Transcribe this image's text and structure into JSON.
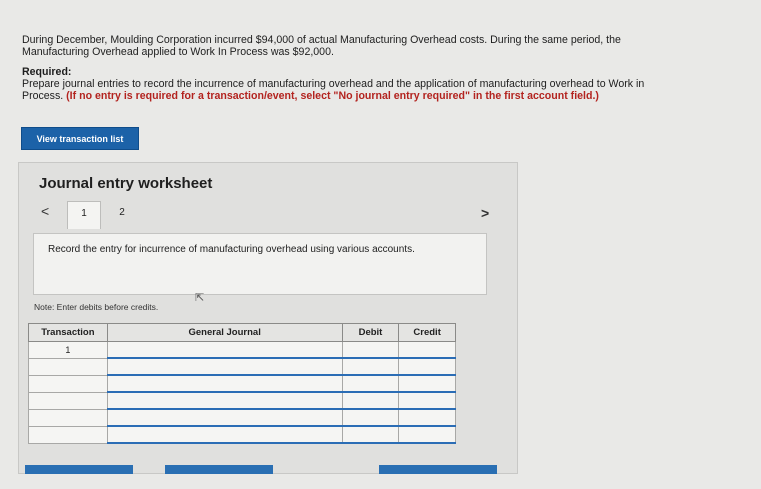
{
  "problem": {
    "line1": "During December, Moulding Corporation incurred $94,000 of actual Manufacturing Overhead costs. During the same period, the",
    "line2": "Manufacturing Overhead applied to Work In Process was $92,000."
  },
  "required": {
    "heading": "Required:",
    "line1": "Prepare journal entries to record the incurrence of manufacturing overhead and the application of manufacturing overhead to Work in",
    "line2_plain": "Process. ",
    "line2_warn": "(If no entry is required for a transaction/event, select \"No journal entry required\" in the first account field.)"
  },
  "view_button": "View transaction list",
  "worksheet": {
    "title": "Journal entry worksheet",
    "prev_glyph": "<",
    "next_glyph": ">",
    "tabs": [
      "1",
      "2"
    ],
    "instruction": "Record the entry for incurrence of manufacturing overhead using various accounts.",
    "note": "Note: Enter debits before credits.",
    "table": {
      "headers": [
        "Transaction",
        "General Journal",
        "Debit",
        "Credit"
      ],
      "rows": [
        [
          "1",
          "",
          "",
          ""
        ],
        [
          "",
          "",
          "",
          ""
        ],
        [
          "",
          "",
          "",
          ""
        ],
        [
          "",
          "",
          "",
          ""
        ],
        [
          "",
          "",
          "",
          ""
        ],
        [
          "",
          "",
          "",
          ""
        ]
      ]
    }
  }
}
